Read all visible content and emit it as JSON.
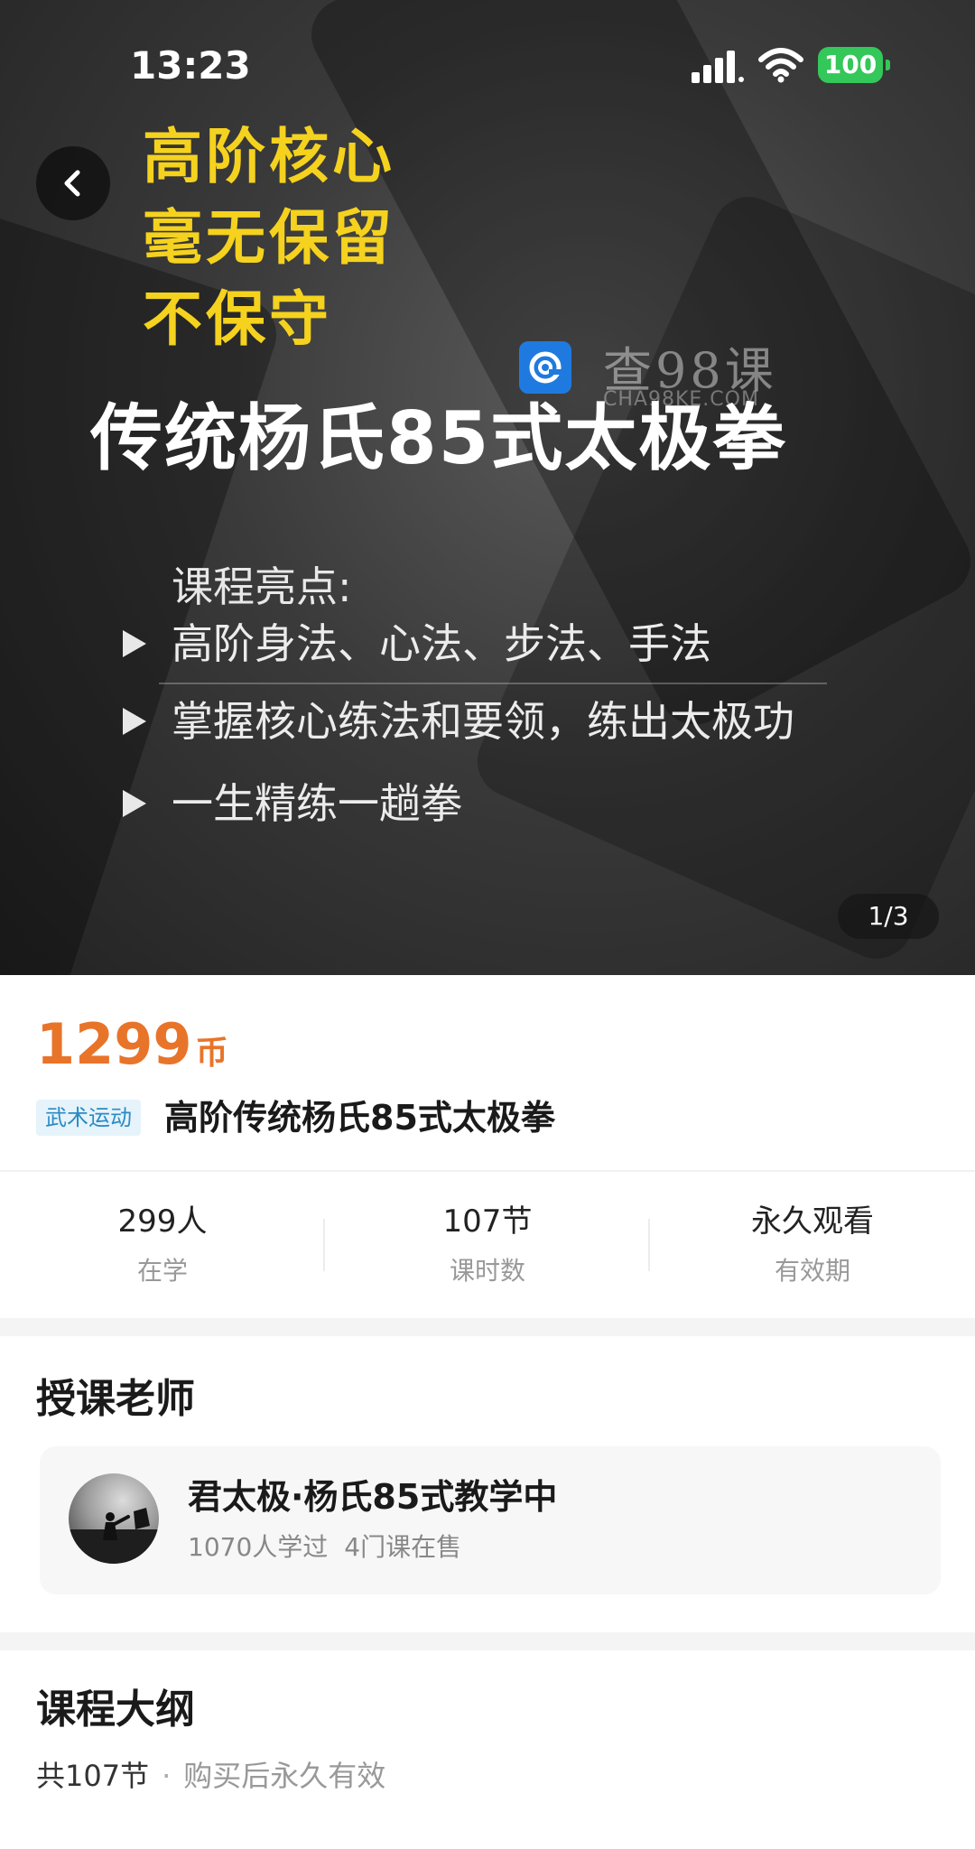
{
  "status_bar": {
    "time": "13:23",
    "battery": "100",
    "battery_color": "#34c759"
  },
  "hero": {
    "tags": [
      "高阶核心",
      "毫无保留",
      "不保守"
    ],
    "watermark": {
      "name": "查98课",
      "url": "CHA98KE.COM"
    },
    "title": "传统杨氏85式太极拳",
    "highlights_title": "课程亮点:",
    "highlights": [
      "高阶身法、心法、步法、手法",
      "掌握核心练法和要领，练出太极功",
      "一生精练一趟拳"
    ],
    "slide_counter": "1/3",
    "tag_color": "#f5d21e"
  },
  "course": {
    "price": "1299",
    "price_unit": "币",
    "price_color": "#e8742a",
    "category": "武术运动",
    "title": "高阶传统杨氏85式太极拳"
  },
  "stats": [
    {
      "value": "299人",
      "label": "在学"
    },
    {
      "value": "107节",
      "label": "课时数"
    },
    {
      "value": "永久观看",
      "label": "有效期"
    }
  ],
  "teacher_section": {
    "heading": "授课老师",
    "name": "君太极·杨氏85式教学中",
    "learners": "1070人学过",
    "courses": "4门课在售"
  },
  "outline_section": {
    "heading": "课程大纲",
    "count": "共107节",
    "separator": "·",
    "validity": "购买后永久有效"
  }
}
